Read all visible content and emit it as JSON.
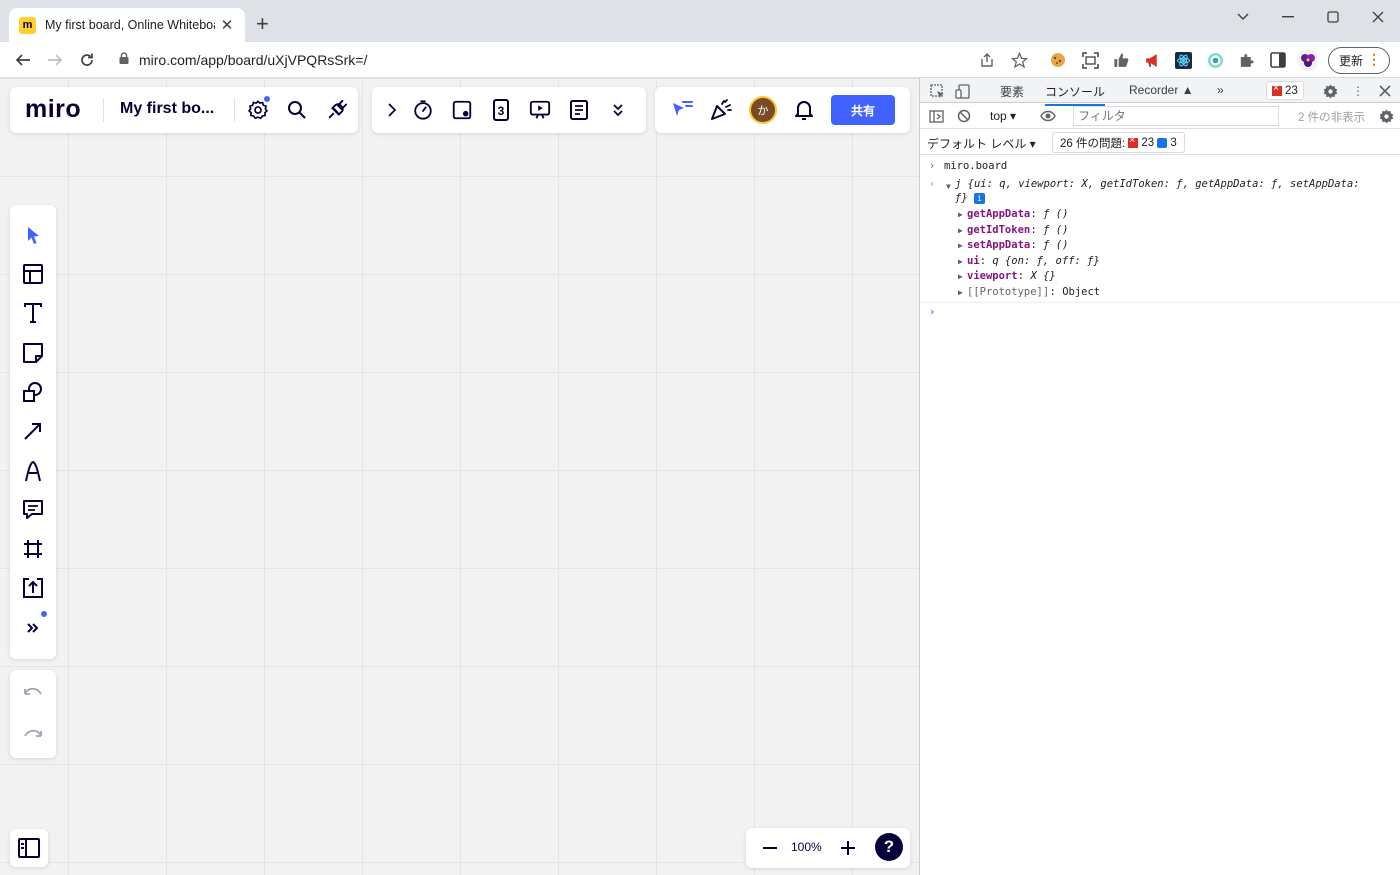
{
  "browser": {
    "tab_title": "My first board, Online Whiteboar",
    "favicon_letter": "m",
    "url": "miro.com/app/board/uXjVPQRsSrk=/",
    "update_label": "更新"
  },
  "miro": {
    "logo": "miro",
    "board_name": "My first bo...",
    "share_label": "共有",
    "avatar_initial": "か",
    "timer_count": "3",
    "zoom_level": "100%",
    "help_label": "?"
  },
  "devtools": {
    "tabs": [
      "要素",
      "コンソール",
      "Recorder",
      "»"
    ],
    "error_count": "23",
    "context": "top ▾",
    "filter_placeholder": "フィルタ",
    "hidden_count": "2 件の非表示",
    "level": "デフォルト レベル ▾",
    "issues_label": "26 件の問題:",
    "issues_errors": "23",
    "issues_info": "3",
    "console": {
      "command": "miro.board",
      "result_summary": "j {ui: q, viewport: X, getIdToken: ƒ, getAppData: ƒ, setAppData:",
      "result_summary_cont": "ƒ}",
      "props": [
        {
          "key": "getAppData",
          "value": "ƒ ()"
        },
        {
          "key": "getIdToken",
          "value": "ƒ ()"
        },
        {
          "key": "setAppData",
          "value": "ƒ ()"
        },
        {
          "key": "ui",
          "value": "q {on: ƒ, off: ƒ}"
        },
        {
          "key": "viewport",
          "value": "X {}"
        },
        {
          "key": "[[Prototype]]",
          "value": "Object"
        }
      ]
    }
  },
  "colors": {
    "accent": "#4262ff",
    "miro_dark": "#050038",
    "devtools_key": "#881280"
  }
}
